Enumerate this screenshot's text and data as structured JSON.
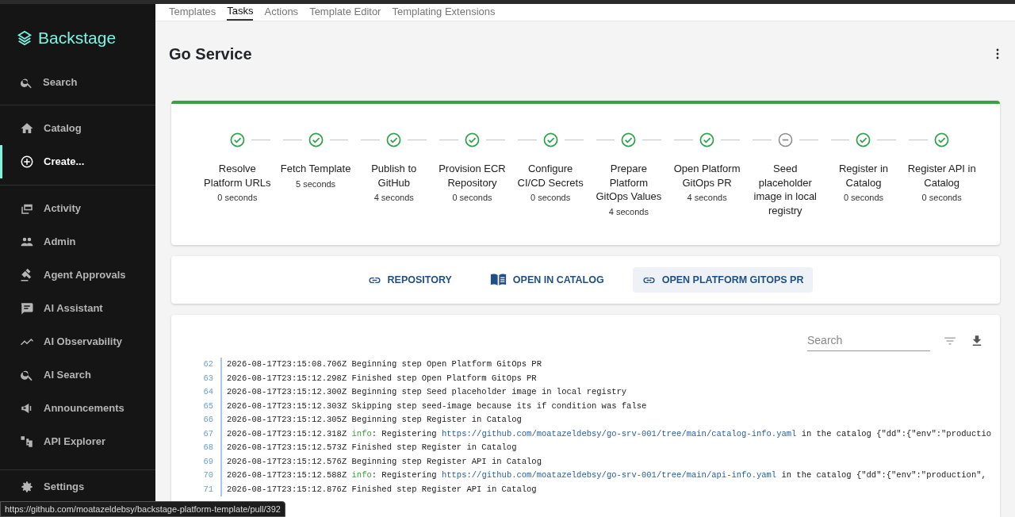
{
  "sidebar": {
    "logo": "Backstage",
    "search": "Search",
    "groups": [
      [
        {
          "label": "Catalog",
          "selected": false
        },
        {
          "label": "Create...",
          "selected": true
        }
      ],
      [
        {
          "label": "Activity",
          "selected": false
        },
        {
          "label": "Admin",
          "selected": false
        },
        {
          "label": "Agent Approvals",
          "selected": false
        },
        {
          "label": "AI Assistant",
          "selected": false
        },
        {
          "label": "AI Observability",
          "selected": false
        },
        {
          "label": "AI Search",
          "selected": false
        },
        {
          "label": "Announcements",
          "selected": false
        },
        {
          "label": "API Explorer",
          "selected": false
        }
      ],
      [
        {
          "label": "Settings",
          "selected": false
        }
      ]
    ]
  },
  "tabs": [
    {
      "label": "Templates",
      "selected": false
    },
    {
      "label": "Tasks",
      "selected": true
    },
    {
      "label": "Actions",
      "selected": false
    },
    {
      "label": "Template Editor",
      "selected": false
    },
    {
      "label": "Templating Extensions",
      "selected": false
    }
  ],
  "page_title": "Go Service",
  "steps": [
    {
      "title": "Resolve Platform URLs",
      "duration": "0 seconds",
      "kind": "done"
    },
    {
      "title": "Fetch Template",
      "duration": "5 seconds",
      "kind": "done"
    },
    {
      "title": "Publish to GitHub",
      "duration": "4 seconds",
      "kind": "done"
    },
    {
      "title": "Provision ECR Repository",
      "duration": "0 seconds",
      "kind": "done"
    },
    {
      "title": "Configure CI/CD Secrets",
      "duration": "0 seconds",
      "kind": "done"
    },
    {
      "title": "Prepare Platform GitOps Values",
      "duration": "4 seconds",
      "kind": "done"
    },
    {
      "title": "Open Platform GitOps PR",
      "duration": "4 seconds",
      "kind": "done"
    },
    {
      "title": "Seed placeholder image in local registry",
      "kind": "skipped"
    },
    {
      "title": "Register in Catalog",
      "duration": "0 seconds",
      "kind": "done"
    },
    {
      "title": "Register API in Catalog",
      "duration": "0 seconds",
      "kind": "done"
    }
  ],
  "links": [
    {
      "label": "REPOSITORY",
      "kind": "link",
      "hovered": false
    },
    {
      "label": "OPEN IN CATALOG",
      "kind": "book",
      "hovered": false
    },
    {
      "label": "OPEN PLATFORM GITOPS PR",
      "kind": "link",
      "hovered": true
    }
  ],
  "log": {
    "search": {
      "placeholder": "Search"
    },
    "lines": [
      {
        "number": "62",
        "kind": "plain",
        "text": "2026-08-17T23:15:08.706Z Beginning step Open Platform GitOps PR"
      },
      {
        "number": "63",
        "kind": "plain",
        "text": "2026-08-17T23:15:12.298Z Finished step Open Platform GitOps PR"
      },
      {
        "number": "64",
        "kind": "plain",
        "text": "2026-08-17T23:15:12.300Z Beginning step Seed placeholder image in local registry"
      },
      {
        "number": "65",
        "kind": "plain",
        "text": "2026-08-17T23:15:12.303Z Skipping step seed-image because its if condition was false"
      },
      {
        "number": "66",
        "kind": "plain",
        "text": "2026-08-17T23:15:12.305Z Beginning step Register in Catalog"
      },
      {
        "number": "67",
        "kind": "info",
        "time": "2026-08-17T23:15:12.318Z",
        "level": "info",
        "message": ": Registering",
        "url": "https://github.com/moatazeldebsy/go-srv-001/tree/main/catalog-info.yaml",
        "rest": "in the catalog {\"dd\":{\"env\":\"productio"
      },
      {
        "number": "68",
        "kind": "plain",
        "text": "2026-08-17T23:15:12.573Z Finished step Register in Catalog"
      },
      {
        "number": "69",
        "kind": "plain",
        "text": "2026-08-17T23:15:12.576Z Beginning step Register API in Catalog"
      },
      {
        "number": "70",
        "kind": "info",
        "time": "2026-08-17T23:15:12.588Z",
        "level": "info",
        "message": ": Registering",
        "url": "https://github.com/moatazeldebsy/go-srv-001/tree/main/api-info.yaml",
        "rest": "in the catalog {\"dd\":{\"env\":\"production\","
      },
      {
        "number": "71",
        "kind": "plain",
        "text": "2026-08-17T23:15:12.876Z Finished step Register API in Catalog"
      }
    ]
  },
  "status_bar": "https://github.com/moatazeldebsy/backstage-platform-template/pull/392"
}
